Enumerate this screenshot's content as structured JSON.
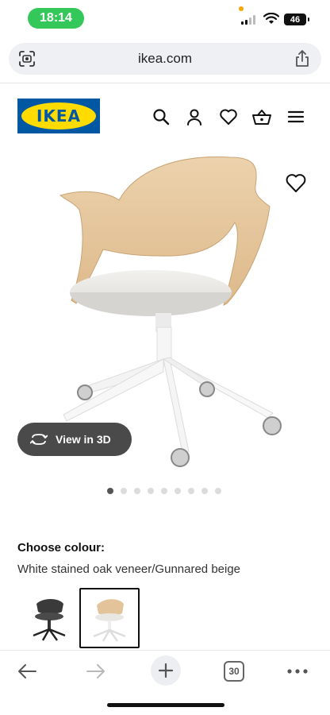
{
  "status_bar": {
    "time": "18:14",
    "battery": "46"
  },
  "browser": {
    "url": "ikea.com",
    "tab_count": "30"
  },
  "header": {
    "logo_text": "IKEA",
    "brand_blue": "#0058a3",
    "brand_yellow": "#ffdb00"
  },
  "product": {
    "view_3d_label": "View in 3D",
    "image_count": 9,
    "active_image_index": 0
  },
  "colour": {
    "label": "Choose colour:",
    "value": "White stained oak veneer/Gunnared beige",
    "swatches": [
      {
        "name": "black",
        "selected": false
      },
      {
        "name": "white-stained-oak",
        "selected": true
      }
    ]
  }
}
